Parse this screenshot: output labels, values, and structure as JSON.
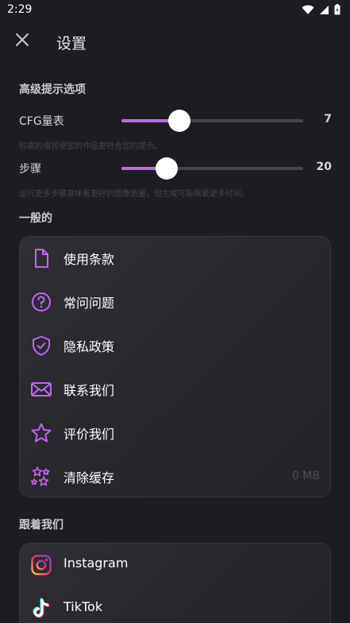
{
  "status": {
    "time": "2:29"
  },
  "header": {
    "title": "设置",
    "close_icon": "close-icon"
  },
  "advanced": {
    "title": "高级提示选项",
    "cfg": {
      "label": "CFG量表",
      "value": "7",
      "fraction": 0.32,
      "hint": "较高的值将使您的作品更符合您的提示。"
    },
    "steps": {
      "label": "步骤",
      "value": "20",
      "fraction": 0.25,
      "hint": "运行更多步骤意味着更好的图像质量，但生成可能需要更多时间。"
    }
  },
  "general": {
    "title": "一般的",
    "items": [
      {
        "label": "使用条款",
        "icon": "document-icon",
        "trailing": ""
      },
      {
        "label": "常问问题",
        "icon": "question-icon",
        "trailing": ""
      },
      {
        "label": "隐私政策",
        "icon": "shield-icon",
        "trailing": ""
      },
      {
        "label": "联系我们",
        "icon": "mail-icon",
        "trailing": ""
      },
      {
        "label": "评价我们",
        "icon": "star-icon",
        "trailing": ""
      },
      {
        "label": "清除缓存",
        "icon": "sparkle-stars-icon",
        "trailing": "0 MB"
      }
    ]
  },
  "follow": {
    "title": "跟着我们",
    "items": [
      {
        "label": "Instagram",
        "icon": "instagram-icon"
      },
      {
        "label": "TikTok",
        "icon": "tiktok-icon"
      }
    ]
  },
  "colors": {
    "accent": "#c664f2",
    "background": "#1d1d21",
    "card": "#2b2b30"
  }
}
